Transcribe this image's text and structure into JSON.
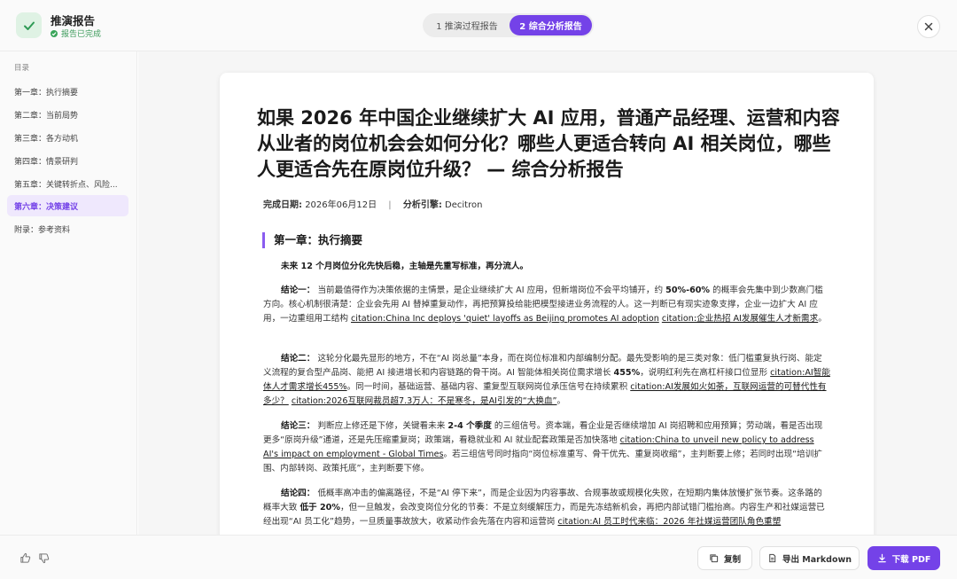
{
  "header": {
    "title": "推演报告",
    "status": "报告已完成",
    "tabs": [
      {
        "label": "1 推演过程报告"
      },
      {
        "label": "2 综合分析报告"
      }
    ]
  },
  "sidebar": {
    "title": "目录",
    "items": [
      {
        "label": "第一章：执行摘要"
      },
      {
        "label": "第二章：当前局势"
      },
      {
        "label": "第三章：各方动机"
      },
      {
        "label": "第四章：情景研判"
      },
      {
        "label": "第五章：关键转折点、风险..."
      },
      {
        "label": "第六章：决策建议"
      },
      {
        "label": "附录：参考资料"
      }
    ]
  },
  "doc": {
    "title": "如果 2026 年中国企业继续扩大 AI 应用，普通产品经理、运营和内容从业者的岗位机会会如何分化？哪些人更适合转向 AI 相关岗位，哪些人更适合先在原岗位升级？ — 综合分析报告",
    "meta_date_label": "完成日期:",
    "meta_date": "2026年06月12日",
    "meta_sep": "|",
    "meta_engine_label": "分析引擎:",
    "meta_engine": "Decitron",
    "chapter": "第一章：执行摘要",
    "lead": "未来 12 个月岗位分化先快后稳，主轴是先重写标准，再分流人。",
    "p1": {
      "label": "结论一：",
      "t1": "当前最值得作为决策依据的主情景，是企业继续扩大 AI 应用，但新增岗位不会平均铺开，约 ",
      "b1": "50%-60%",
      "t2": " 的概率会先集中到少数高门槛方向。核心机制很清楚：企业会先用 AI 替掉重复动作，再把预算投给能把模型接进业务流程的人。这一判断已有现实迹象支撑，企业一边扩大 AI 应用，一边重组用工结构 ",
      "c1": "citation:China Inc deploys 'quiet' layoffs as Beijing promotes AI adoption",
      "c2": "citation:企业热招 AI发展催生人才新需求",
      "end": "。"
    },
    "p2": {
      "label": "结论二：",
      "t1": "这轮分化最先显形的地方，不在“AI 岗总量”本身，而在岗位标准和内部编制分配。最先受影响的是三类对象：低门槛重复执行岗、能定义流程的复合型产品岗、能把 AI 接进增长和内容链路的骨干岗。AI 智能体相关岗位需求增长 ",
      "b1": "455%",
      "t2": "，说明红利先在高杠杆接口位显形 ",
      "c1": "citation:AI智能体人才需求增长455%",
      "t3": "。同一时间，基础运营、基础内容、重复型互联网岗位承压信号在持续累积 ",
      "c2": "citation:AI发展如火如荼，互联网运营的可替代性有多少？",
      "c3": "citation:2026互联网裁员超7.3万人：不是寒冬，是AI引发的“大换血”",
      "end": "。"
    },
    "p3": {
      "label": "结论三：",
      "t1": "判断应上修还是下修，关键看未来 ",
      "b1": "2-4 个季度",
      "t2": " 的三组信号。资本端，看企业是否继续增加 AI 岗招聘和应用预算；劳动端，看是否出现更多“原岗升级”通道，还是先压缩重复岗；政策端，看稳就业和 AI 就业配套政策是否加快落地 ",
      "c1": "citation:China to unveil new policy to address AI's impact on employment - Global Times",
      "t3": "。若三组信号同时指向“岗位标准重写、骨干优先、重复岗收缩”，主判断要上修；若同时出现“培训扩围、内部转岗、政策托底”，主判断要下修。"
    },
    "p4": {
      "label": "结论四：",
      "t1": "低概率高冲击的偏离路径，不是“AI 停下来”，而是企业因为内容事故、合规事故或规模化失败，在短期内集体放慢扩张节奏。这条路的概率大致 ",
      "b1": "低于 20%",
      "t2": "，但一旦触发，会改变岗位分化的节奏：不是立刻缓解压力，而是先冻结新机会，再把内部试错门槛抬高。内容生产和社媒运营已经出现“AI 员工化”趋势，一旦质量事故放大，收紧动作会先落在内容和运营岗 ",
      "c1": "citation:AI 员工时代来临：2026 年社媒运营团队角色重塑"
    }
  },
  "footer": {
    "copy_label": "复制",
    "export_label": "导出 Markdown",
    "pdf_label": "下载 PDF"
  },
  "colors": {
    "accent": "#7442e8",
    "success": "#3aa55a"
  }
}
